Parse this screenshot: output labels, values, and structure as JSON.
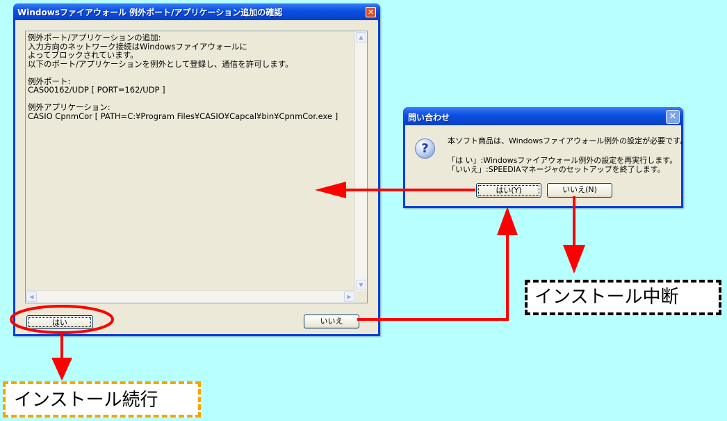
{
  "main_window": {
    "title": "Windowsファイアウォール 例外ポート/アプリケーション追加の確認",
    "close_glyph": "✕",
    "content_lines": [
      "例外ポート/アプリケーションの追加:",
      "入力方向のネットワーク接続はWindowsファイアウォールに",
      "よってブロックされています。",
      "以下のポート/アプリケーションを例外として登録し、通信を許可します。",
      "",
      "例外ポート:",
      "CAS00162/UDP [ PORT=162/UDP ]",
      "",
      "例外アプリケーション:",
      "CASIO CpnmCor [ PATH=C:¥Program Files¥CASIO¥Capcal¥bin¥CpnmCor.exe ]"
    ],
    "yes_button": "はい",
    "no_button": "いいえ"
  },
  "inquiry_dialog": {
    "title": "問い合わせ",
    "close_glyph": "✕",
    "icon": "question-icon",
    "icon_glyph": "?",
    "message_1": "本ソフト商品は、Windowsファイアウォール例外の設定が必要です。",
    "message_2": "「は い」:Windowsファイアウォール例外の設定を再実行します。",
    "message_3": "「いいえ」:SPEEDIAマネージャのセットアップを終了します。",
    "yes_button": "はい(Y)",
    "no_button": "いいえ(N)"
  },
  "annotations": {
    "abort_label": "インストール中断",
    "continue_label": "インストール続行",
    "arrow_color": "#ff0000",
    "abort_border_color": "#000000",
    "continue_border_color": "#f5a500"
  }
}
